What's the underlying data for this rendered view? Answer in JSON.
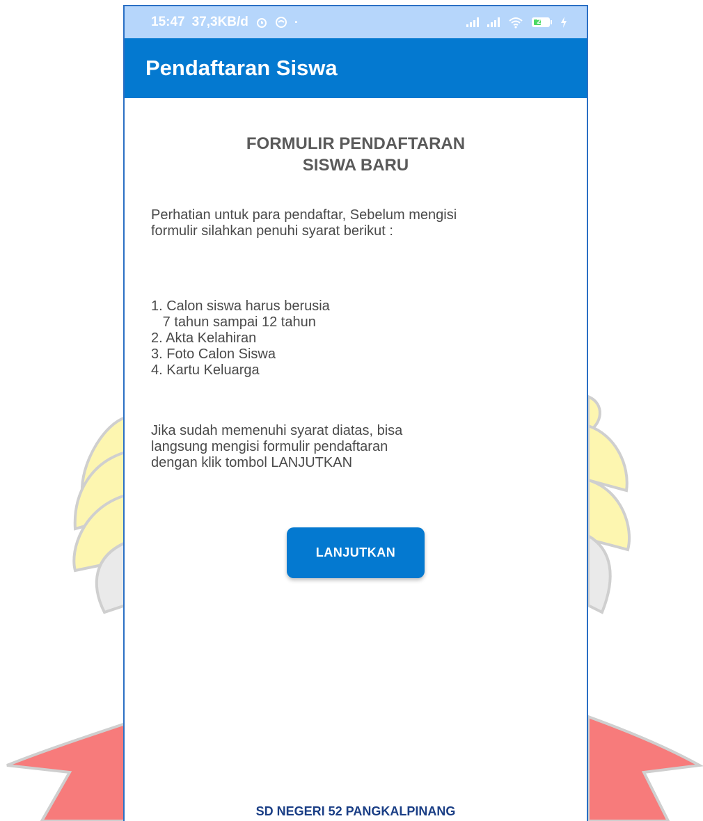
{
  "status_bar": {
    "time": "15:47",
    "speed": "37,3KB/d",
    "dot": "·",
    "battery_level": "25",
    "icons": [
      "alarm-icon",
      "wifi-off-circle-icon",
      "signal-icon",
      "signal-icon",
      "wifi-icon",
      "battery-icon",
      "charging-icon"
    ]
  },
  "app_bar": {
    "title": "Pendaftaran Siswa"
  },
  "form": {
    "title_line1": "FORMULIR PENDAFTARAN",
    "title_line2": "SISWA BARU",
    "notice_line1": "Perhatian untuk para pendaftar, Sebelum mengisi",
    "notice_line2": "formulir silahkan penuhi syarat berikut :",
    "requirements": [
      "1. Calon siswa harus berusia",
      "   7 tahun sampai 12 tahun",
      "2. Akta Kelahiran",
      "3. Foto Calon Siswa",
      "4. Kartu Keluarga"
    ],
    "followup_line1": "Jika sudah memenuhi syarat diatas, bisa",
    "followup_line2": "langsung mengisi formulir pendaftaran",
    "followup_line3": "dengan klik tombol LANJUTKAN",
    "button_label": "LANJUTKAN"
  },
  "footer": {
    "school_name": "SD NEGERI 52 PANGKALPINANG"
  },
  "colors": {
    "app_bar": "#0479d0",
    "status_bar": "#b6d6fb",
    "button": "#0479d0",
    "footer_text": "#1a3e85",
    "emblem_yellow": "#fdf6b0",
    "emblem_red": "#f77b7b"
  }
}
